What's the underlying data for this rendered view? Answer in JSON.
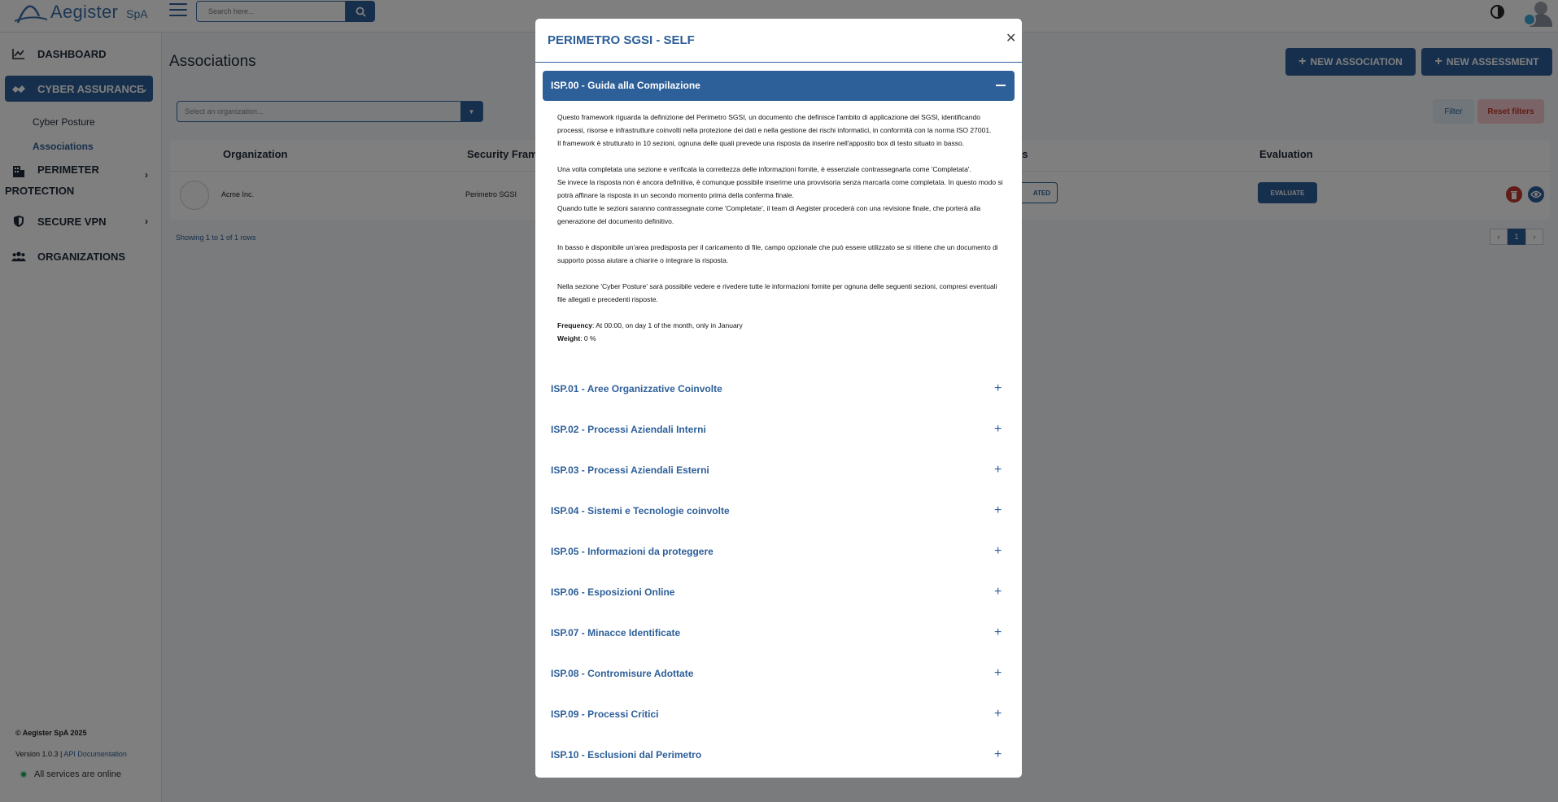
{
  "header": {
    "logo_text": "Aegister",
    "logo_sub": "SpA",
    "search_placeholder": "Search here..."
  },
  "sidebar": {
    "items": [
      {
        "label": "DASHBOARD",
        "icon": "chart-line-icon"
      },
      {
        "label": "CYBER ASSURANCE",
        "icon": "handshake-icon"
      },
      {
        "label": "PERIMETER",
        "label2": "PROTECTION",
        "icon": "building-icon"
      },
      {
        "label": "SECURE VPN",
        "icon": "shield-icon"
      },
      {
        "label": "ORGANIZATIONS",
        "icon": "users-icon"
      }
    ],
    "sub_items": [
      "Cyber Posture",
      "Associations"
    ],
    "footer_copyright": "© Aegister SpA 2025",
    "footer_version": "Version 1.0.3 |",
    "footer_api_link": "API Documentation",
    "footer_status": "All services are online"
  },
  "main": {
    "title": "Associations",
    "new_association": "NEW ASSOCIATION",
    "new_assessment": "NEW ASSESSMENT",
    "org_select_placeholder": "Select an organization...",
    "filter": "Filter",
    "reset_filters": "Reset filters",
    "columns": [
      "Organization",
      "Security Fram",
      "ils",
      "Evaluation"
    ],
    "row": {
      "organization": "Acme Inc.",
      "security_framework": "Perimetro SGSI",
      "status": "ATED",
      "evaluate": "EVALUATE"
    },
    "rows_info": "Showing 1 to 1 of 1 rows",
    "pager": [
      "‹",
      "1",
      "›"
    ]
  },
  "modal": {
    "title": "PERIMETRO SGSI - SELF",
    "open_section": "ISP.00 - Guida alla Compilazione",
    "body": {
      "p1": "Questo framework riguarda la definizione del Perimetro SGSI, un documento che definisce l'ambito di applicazione del SGSI, identificando processi, risorse e infrastrutture coinvolti nella protezione dei dati e nella gestione dei rischi informatici, in conformità con la norma ISO 27001.",
      "p2": "Il framework è strutturato in 10 sezioni, ognuna delle quali prevede una risposta da inserire nell'apposito box di testo situato in basso.",
      "p3": "Una volta completata una sezione e verificata la correttezza delle informazioni fornite, è essenziale contrassegnarla come 'Completata'.",
      "p4": "Se invece la risposta non è ancora definitiva, è comunque possibile inserirne una provvisoria senza marcarla come completata. In questo modo si potrà affinare la risposta in un secondo momento prima della conferma finale.",
      "p5": "Quando tutte le sezioni saranno contrassegnate come 'Completate', il team di Aegister procederà con una revisione finale, che porterà alla generazione del documento definitivo.",
      "p6": "In basso è disponibile un'area predisposta per il caricamento di file, campo opzionale che può essere utilizzato se si ritiene che un documento di supporto possa aiutare a chiarire o integrare la risposta.",
      "p7": "Nella sezione 'Cyber Posture' sarà possibile vedere e rivedere tutte le informazioni fornite per ognuna delle seguenti sezioni, compresi eventuali file allegati e precedenti risposte.",
      "frequency_label": "Frequency",
      "frequency_value": ": At 00:00, on day 1 of the month, only in January",
      "weight_label": "Weight",
      "weight_value": ": 0 %"
    },
    "sections": [
      "ISP.01 - Aree Organizzative Coinvolte",
      "ISP.02 - Processi Aziendali Interni",
      "ISP.03 - Processi Aziendali Esterni",
      "ISP.04 - Sistemi e Tecnologie coinvolte",
      "ISP.05 - Informazioni da proteggere",
      "ISP.06 - Esposizioni Online",
      "ISP.07 - Minacce Identificate",
      "ISP.08 - Contromisure Adottate",
      "ISP.09 - Processi Critici",
      "ISP.10 - Esclusioni dal Perimetro"
    ]
  },
  "colors": {
    "primary": "#2d5f99",
    "danger": "#c0392b",
    "success": "#27ae60"
  }
}
